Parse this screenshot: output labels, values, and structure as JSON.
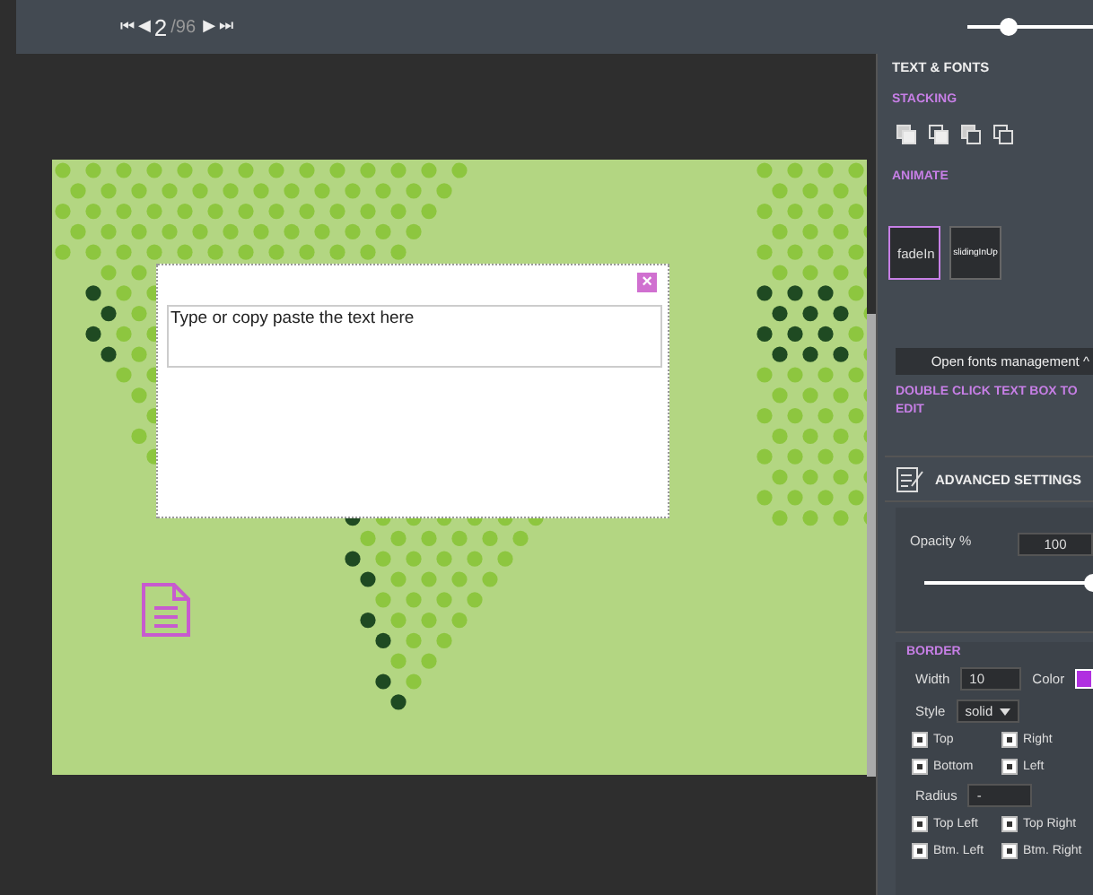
{
  "toolbar": {
    "first": "⏮",
    "prev": "◀",
    "current_page": "2",
    "total_pages": "/96",
    "next": "▶",
    "last": "⏭",
    "zoom": {
      "level": 0.25
    }
  },
  "slide": {
    "editor": {
      "text": "Type or copy paste the text here",
      "close": "×"
    }
  },
  "panel": {
    "section_title": "TEXT & FONTS",
    "stacking": {
      "title": "STACKING"
    },
    "animate": {
      "title": "ANIMATE",
      "options": [
        {
          "label": "fadeIn",
          "selected": true
        },
        {
          "label": "slidingInUp",
          "selected": false
        }
      ]
    },
    "fonts_button": "Open fonts management ^",
    "hint": "DOUBLE CLICK TEXT BOX TO EDIT",
    "advanced": {
      "title": "ADVANCED SETTINGS",
      "opacity_label": "Opacity %",
      "opacity_value": "100",
      "opacity": {
        "level": 1
      }
    },
    "border": {
      "title": "BORDER",
      "width_label": "Width",
      "width_value": "10",
      "color_label": "Color",
      "color": "#b030e0",
      "style_label": "Style",
      "style_value": "solid",
      "sides": [
        {
          "label": "Top",
          "checked": true
        },
        {
          "label": "Right",
          "checked": true
        },
        {
          "label": "Bottom",
          "checked": true
        },
        {
          "label": "Left",
          "checked": true
        }
      ],
      "radius_label": "Radius",
      "radius_value": "-",
      "corners": [
        {
          "label": "Top Left",
          "checked": true
        },
        {
          "label": "Top Right",
          "checked": true
        },
        {
          "label": "Btm. Left",
          "checked": true
        },
        {
          "label": "Btm. Right",
          "checked": true
        }
      ]
    }
  }
}
